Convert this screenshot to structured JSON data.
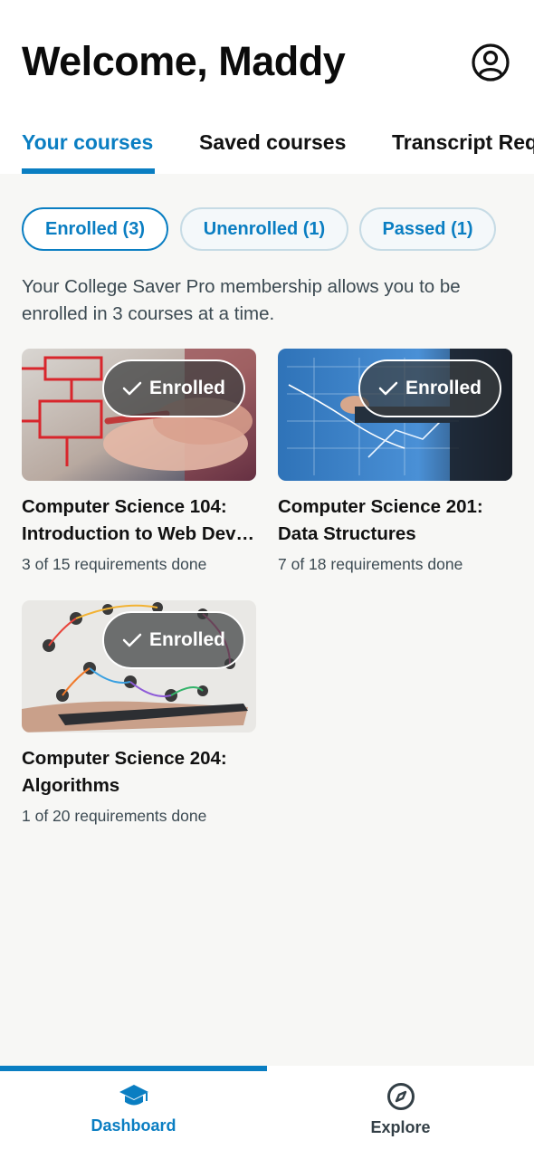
{
  "header": {
    "welcome": "Welcome, Maddy",
    "account_icon": "account-circle-icon"
  },
  "tabs": [
    {
      "label": "Your courses",
      "active": true
    },
    {
      "label": "Saved courses",
      "active": false
    },
    {
      "label": "Transcript Requests",
      "active": false
    }
  ],
  "filters": [
    {
      "label": "Enrolled (3)",
      "active": true
    },
    {
      "label": "Unenrolled (1)",
      "active": false
    },
    {
      "label": "Passed (1)",
      "active": false
    }
  ],
  "membership_note": "Your College Saver Pro membership allows you to be enrolled in 3 courses at a time.",
  "courses": [
    {
      "title_line1": "Computer Science 104:",
      "title_line2": "Introduction to Web Development",
      "requirements": "3 of 15 requirements done",
      "badge": "Enrolled",
      "image_icon": "flowchart-drawing-image"
    },
    {
      "title_line1": "Computer Science 201:",
      "title_line2": "Data Structures",
      "requirements": "7 of 18 requirements done",
      "badge": "Enrolled",
      "image_icon": "data-charts-image"
    },
    {
      "title_line1": "Computer Science 204:",
      "title_line2": "Algorithms",
      "requirements": "1 of 20 requirements done",
      "badge": "Enrolled",
      "image_icon": "network-tablet-image"
    }
  ],
  "bottom_nav": [
    {
      "label": "Dashboard",
      "icon": "graduation-cap-icon",
      "active": true
    },
    {
      "label": "Explore",
      "icon": "compass-icon",
      "active": false
    }
  ],
  "colors": {
    "accent": "#0a7ec2",
    "background": "#f7f7f5",
    "chip_border": "#c6dbe5",
    "muted_text": "#3c4a52"
  }
}
